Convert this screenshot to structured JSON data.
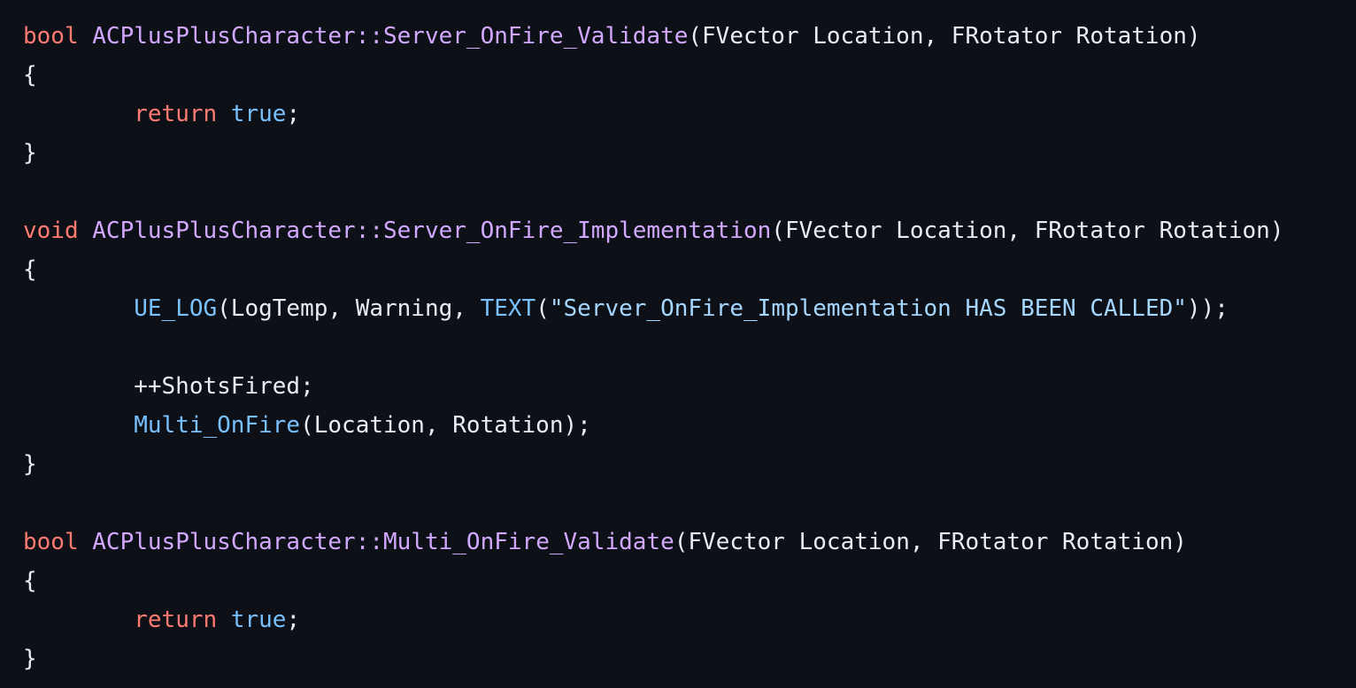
{
  "colors": {
    "background": "#0d1117",
    "plain": "#e6edf3",
    "keyword": "#ff7b72",
    "function": "#d2a8ff",
    "constant": "#79c0ff",
    "string": "#a5d6ff"
  },
  "code": {
    "language": "cpp",
    "lines": [
      [
        {
          "t": "keyword",
          "v": "bool"
        },
        {
          "t": "plain",
          "v": " "
        },
        {
          "t": "function",
          "v": "ACPlusPlusCharacter::Server_OnFire_Validate"
        },
        {
          "t": "plain",
          "v": "(FVector Location, FRotator Rotation)"
        }
      ],
      [
        {
          "t": "plain",
          "v": "{"
        }
      ],
      [
        {
          "t": "plain",
          "v": "        "
        },
        {
          "t": "keyword",
          "v": "return"
        },
        {
          "t": "plain",
          "v": " "
        },
        {
          "t": "constant",
          "v": "true"
        },
        {
          "t": "plain",
          "v": ";"
        }
      ],
      [
        {
          "t": "plain",
          "v": "}"
        }
      ],
      [],
      [
        {
          "t": "keyword",
          "v": "void"
        },
        {
          "t": "plain",
          "v": " "
        },
        {
          "t": "function",
          "v": "ACPlusPlusCharacter::Server_OnFire_Implementation"
        },
        {
          "t": "plain",
          "v": "(FVector Location, FRotator Rotation)"
        }
      ],
      [
        {
          "t": "plain",
          "v": "{"
        }
      ],
      [
        {
          "t": "plain",
          "v": "        "
        },
        {
          "t": "constant",
          "v": "UE_LOG"
        },
        {
          "t": "plain",
          "v": "(LogTemp, Warning, "
        },
        {
          "t": "constant",
          "v": "TEXT"
        },
        {
          "t": "plain",
          "v": "("
        },
        {
          "t": "string",
          "v": "\"Server_OnFire_Implementation HAS BEEN CALLED\""
        },
        {
          "t": "plain",
          "v": "));"
        }
      ],
      [],
      [
        {
          "t": "plain",
          "v": "        ++ShotsFired;"
        }
      ],
      [
        {
          "t": "plain",
          "v": "        "
        },
        {
          "t": "constant",
          "v": "Multi_OnFire"
        },
        {
          "t": "plain",
          "v": "(Location, Rotation);"
        }
      ],
      [
        {
          "t": "plain",
          "v": "}"
        }
      ],
      [],
      [
        {
          "t": "keyword",
          "v": "bool"
        },
        {
          "t": "plain",
          "v": " "
        },
        {
          "t": "function",
          "v": "ACPlusPlusCharacter::Multi_OnFire_Validate"
        },
        {
          "t": "plain",
          "v": "(FVector Location, FRotator Rotation)"
        }
      ],
      [
        {
          "t": "plain",
          "v": "{"
        }
      ],
      [
        {
          "t": "plain",
          "v": "        "
        },
        {
          "t": "keyword",
          "v": "return"
        },
        {
          "t": "plain",
          "v": " "
        },
        {
          "t": "constant",
          "v": "true"
        },
        {
          "t": "plain",
          "v": ";"
        }
      ],
      [
        {
          "t": "plain",
          "v": "}"
        }
      ]
    ]
  }
}
